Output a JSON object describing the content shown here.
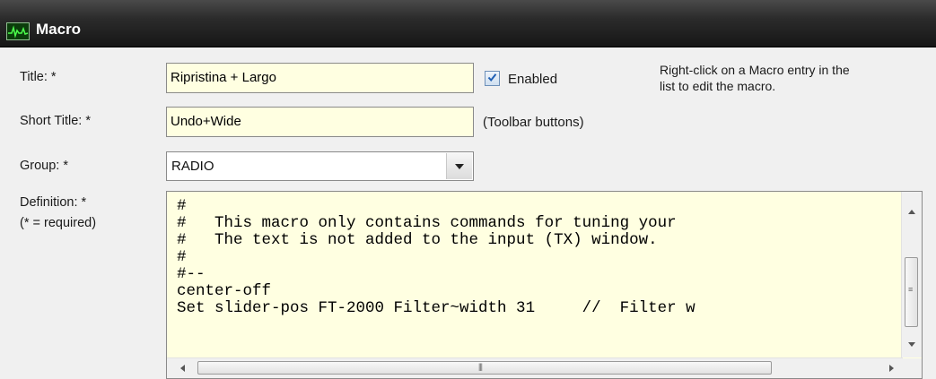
{
  "window": {
    "title": "Macro",
    "icon": "waveform-app-icon"
  },
  "form": {
    "title_label": "Title: *",
    "title_value": "Ripristina + Largo",
    "short_title_label": "Short Title: *",
    "short_title_value": "Undo+Wide",
    "short_title_hint": "(Toolbar buttons)",
    "group_label": "Group: *",
    "group_value": "RADIO",
    "definition_label": "Definition: *",
    "required_note": "(* = required)",
    "enabled_label": "Enabled",
    "enabled_checked": true,
    "help_text_line1": "Right-click on a Macro entry in the",
    "help_text_line2": "list to edit the macro."
  },
  "definition_lines": [
    "#",
    "#   This macro only contains commands for tuning your",
    "#   The text is not added to the input (TX) window.",
    "#",
    "#--",
    "center-off",
    "Set slider-pos FT-2000 Filter~width 31     //  Filter w"
  ],
  "colors": {
    "field_bg": "#ffffe1",
    "titlebar": "#1e1e1e",
    "checkbox_accent": "#1f5fb4"
  }
}
